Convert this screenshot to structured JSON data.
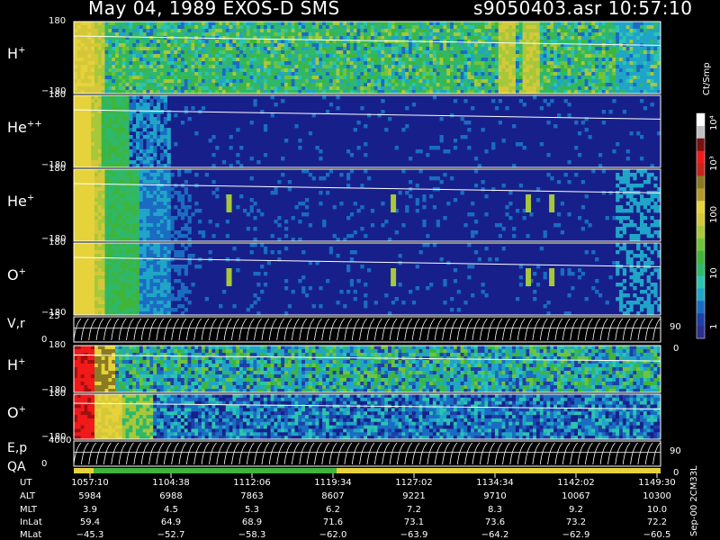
{
  "header": {
    "title_left": "May 04, 1989   EXOS-D SMS",
    "title_right": "s9050403.asr  10:57:10"
  },
  "chart_data": {
    "type": "heatmap",
    "panels": [
      {
        "id": "h_plus",
        "label": "H",
        "sup": "+",
        "ymax": "180",
        "ymin": "−180",
        "style": "ion"
      },
      {
        "id": "he_pp",
        "label": "He",
        "sup": "++",
        "ymax": "180",
        "ymin": "−180",
        "style": "quiet"
      },
      {
        "id": "he_p",
        "label": "He",
        "sup": "+",
        "ymax": "180",
        "ymin": "−180",
        "style": "sparse"
      },
      {
        "id": "o_plus",
        "label": "O",
        "sup": "+",
        "ymax": "180",
        "ymin": "−180",
        "style": "sparse"
      },
      {
        "id": "vr",
        "label": "V,r",
        "sup": "",
        "ymax": "25",
        "ymin": "0",
        "right_top": "90",
        "right_bottom": "0",
        "style": "line"
      },
      {
        "id": "h_plus2",
        "label": "H",
        "sup": "+",
        "ymax": "180",
        "ymin": "−180",
        "style": "dense"
      },
      {
        "id": "o_plus2",
        "label": "O",
        "sup": "+",
        "ymax": "180",
        "ymin": "−180",
        "style": "dense2"
      },
      {
        "id": "ep",
        "label": "E,p",
        "sup": "",
        "ymax": "4000",
        "ymin": "0",
        "right_top": "90",
        "right_bottom": "0",
        "style": "line"
      }
    ],
    "qa_label": "QA",
    "colorbar": {
      "unit": "Ct/Smp",
      "ticks": [
        "10⁴",
        "10³",
        "100",
        "10",
        "1"
      ],
      "colors": [
        "#2b2f8f",
        "#1e3fa8",
        "#1a6cc2",
        "#20a5c8",
        "#2cc4b0",
        "#2fb86a",
        "#3fb53a",
        "#6fc43a",
        "#a6c83a",
        "#d4c83a",
        "#e6d23a",
        "#b49a2a",
        "#8a7a22",
        "#c8231c",
        "#f01a1a",
        "#7a1010",
        "#c0c0c0",
        "#ffffff"
      ]
    },
    "footer": {
      "rows": [
        {
          "label": "UT",
          "values": [
            "1057:10",
            "1104:38",
            "1112:06",
            "1119:34",
            "1127:02",
            "1134:34",
            "1142:02",
            "1149:30"
          ]
        },
        {
          "label": "ALT",
          "values": [
            "5984",
            "6988",
            "7863",
            "8607",
            "9221",
            "9710",
            "10067",
            "10300"
          ]
        },
        {
          "label": "MLT",
          "values": [
            "3.9",
            "4.5",
            "5.3",
            "6.2",
            "7.2",
            "8.3",
            "9.2",
            "10.0"
          ]
        },
        {
          "label": "InLat",
          "values": [
            "59.4",
            "64.9",
            "68.9",
            "71.6",
            "73.1",
            "73.6",
            "73.2",
            "72.2"
          ]
        },
        {
          "label": "MLat",
          "values": [
            "−45.3",
            "−52.7",
            "−58.3",
            "−62.0",
            "−63.9",
            "−64.2",
            "−62.9",
            "−60.5"
          ]
        }
      ]
    },
    "side_note": "Sep-00  2CM33L"
  }
}
